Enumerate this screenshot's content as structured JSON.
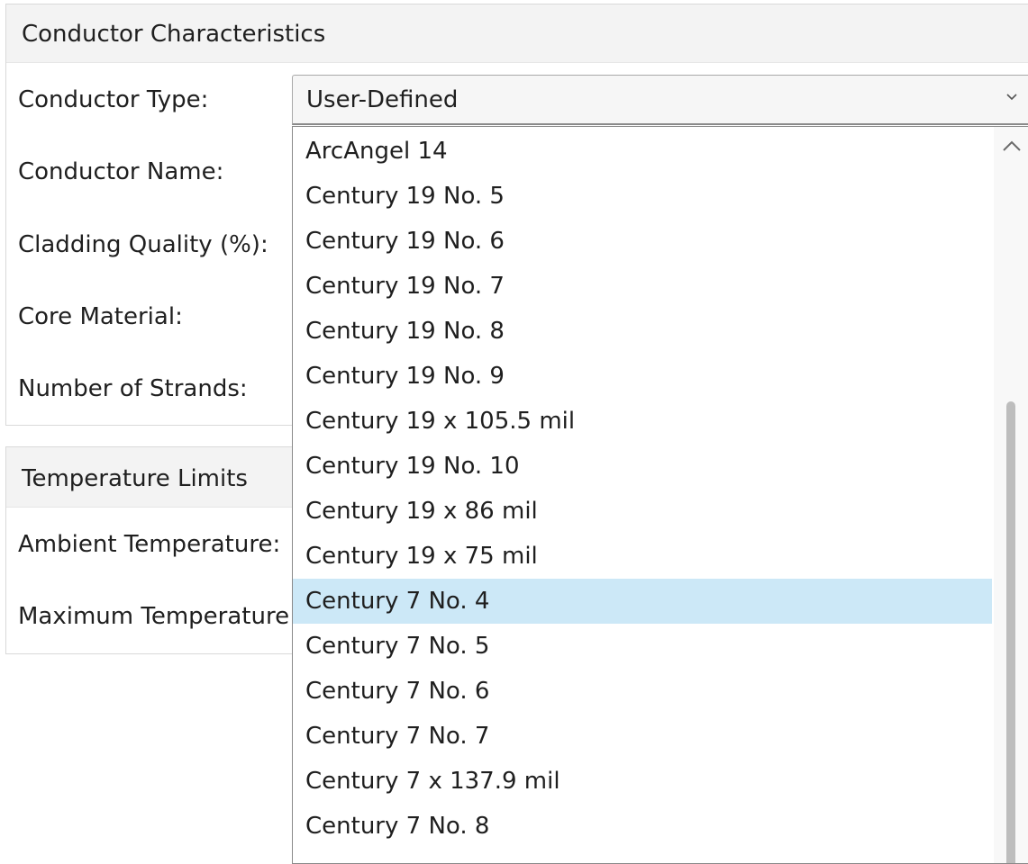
{
  "conductor_characteristics": {
    "title": "Conductor Characteristics",
    "fields": {
      "conductor_type": "Conductor Type:",
      "conductor_name": "Conductor Name:",
      "cladding_quality": "Cladding Quality (%):",
      "core_material": "Core Material:",
      "number_of_strands": "Number of Strands:"
    },
    "conductor_type_combo": {
      "selected_value": "User-Defined",
      "arrow_icon": "chevron-down-icon"
    }
  },
  "temperature_limits": {
    "title": "Temperature Limits",
    "fields": {
      "ambient_temperature": "Ambient Temperature:",
      "maximum_temperature": "Maximum Temperature"
    }
  },
  "dropdown": {
    "items": [
      "ArcAngel 14",
      "Century 19 No. 5",
      "Century 19 No. 6",
      "Century 19 No. 7",
      "Century 19 No. 8",
      "Century 19 No. 9",
      "Century 19 x 105.5 mil",
      "Century 19 No. 10",
      "Century 19 x 86 mil",
      "Century 19 x 75 mil",
      "Century 7 No. 4",
      "Century 7 No. 5",
      "Century 7 No. 6",
      "Century 7 No. 7",
      "Century 7 x 137.9 mil",
      "Century 7 No. 8"
    ],
    "highlighted_item": "Century 7 No. 4",
    "highlight_color": "#cce8f7",
    "scroll_up_icon": "chevron-up-icon"
  }
}
